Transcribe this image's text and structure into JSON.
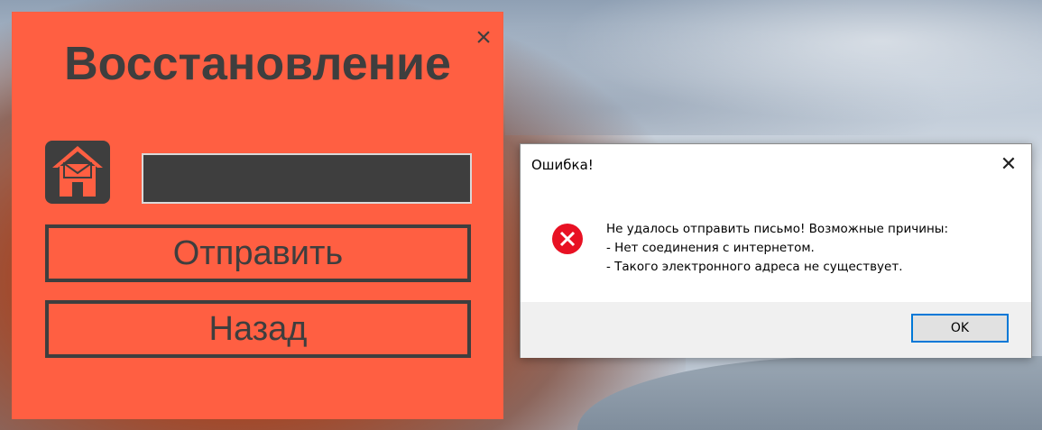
{
  "recovery_window": {
    "title": "Восстановление",
    "close_glyph": "×",
    "email_icon": "house-envelope-icon",
    "email_value": "",
    "send_label": "Отправить",
    "back_label": "Назад",
    "accent_color": "#ff5f42",
    "dark_color": "#3e3e3e"
  },
  "error_dialog": {
    "title": "Ошибка!",
    "close_glyph": "✕",
    "icon": "error-circle-icon",
    "message_lines": [
      "Не удалось отправить письмо! Возможные причины:",
      "- Нет соединения с интернетом.",
      "- Такого электронного адреса не существует."
    ],
    "ok_label": "OK",
    "error_color": "#e81123",
    "focus_color": "#0078d7"
  }
}
